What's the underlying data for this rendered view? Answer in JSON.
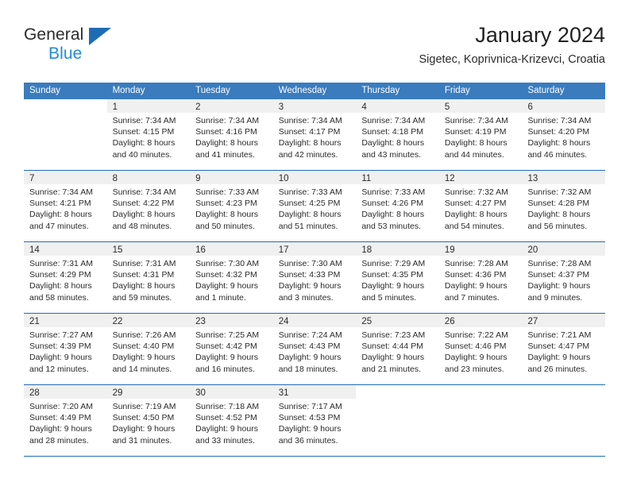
{
  "brand": {
    "line1": "General",
    "line2": "Blue",
    "triangle_color": "#1f6cb6",
    "blue_text_color": "#1f8bd8"
  },
  "header": {
    "title": "January 2024",
    "subtitle": "Sigetec, Koprivnica-Krizevci, Croatia"
  },
  "theme": {
    "header_row_bg": "#3a7cbe",
    "row_divider": "#1f6cb6",
    "day_number_band": "#f0f0f0"
  },
  "weekdays": [
    "Sunday",
    "Monday",
    "Tuesday",
    "Wednesday",
    "Thursday",
    "Friday",
    "Saturday"
  ],
  "weeks": [
    [
      {
        "day": "",
        "lines": []
      },
      {
        "day": "1",
        "lines": [
          "Sunrise: 7:34 AM",
          "Sunset: 4:15 PM",
          "Daylight: 8 hours",
          "and 40 minutes."
        ]
      },
      {
        "day": "2",
        "lines": [
          "Sunrise: 7:34 AM",
          "Sunset: 4:16 PM",
          "Daylight: 8 hours",
          "and 41 minutes."
        ]
      },
      {
        "day": "3",
        "lines": [
          "Sunrise: 7:34 AM",
          "Sunset: 4:17 PM",
          "Daylight: 8 hours",
          "and 42 minutes."
        ]
      },
      {
        "day": "4",
        "lines": [
          "Sunrise: 7:34 AM",
          "Sunset: 4:18 PM",
          "Daylight: 8 hours",
          "and 43 minutes."
        ]
      },
      {
        "day": "5",
        "lines": [
          "Sunrise: 7:34 AM",
          "Sunset: 4:19 PM",
          "Daylight: 8 hours",
          "and 44 minutes."
        ]
      },
      {
        "day": "6",
        "lines": [
          "Sunrise: 7:34 AM",
          "Sunset: 4:20 PM",
          "Daylight: 8 hours",
          "and 46 minutes."
        ]
      }
    ],
    [
      {
        "day": "7",
        "lines": [
          "Sunrise: 7:34 AM",
          "Sunset: 4:21 PM",
          "Daylight: 8 hours",
          "and 47 minutes."
        ]
      },
      {
        "day": "8",
        "lines": [
          "Sunrise: 7:34 AM",
          "Sunset: 4:22 PM",
          "Daylight: 8 hours",
          "and 48 minutes."
        ]
      },
      {
        "day": "9",
        "lines": [
          "Sunrise: 7:33 AM",
          "Sunset: 4:23 PM",
          "Daylight: 8 hours",
          "and 50 minutes."
        ]
      },
      {
        "day": "10",
        "lines": [
          "Sunrise: 7:33 AM",
          "Sunset: 4:25 PM",
          "Daylight: 8 hours",
          "and 51 minutes."
        ]
      },
      {
        "day": "11",
        "lines": [
          "Sunrise: 7:33 AM",
          "Sunset: 4:26 PM",
          "Daylight: 8 hours",
          "and 53 minutes."
        ]
      },
      {
        "day": "12",
        "lines": [
          "Sunrise: 7:32 AM",
          "Sunset: 4:27 PM",
          "Daylight: 8 hours",
          "and 54 minutes."
        ]
      },
      {
        "day": "13",
        "lines": [
          "Sunrise: 7:32 AM",
          "Sunset: 4:28 PM",
          "Daylight: 8 hours",
          "and 56 minutes."
        ]
      }
    ],
    [
      {
        "day": "14",
        "lines": [
          "Sunrise: 7:31 AM",
          "Sunset: 4:29 PM",
          "Daylight: 8 hours",
          "and 58 minutes."
        ]
      },
      {
        "day": "15",
        "lines": [
          "Sunrise: 7:31 AM",
          "Sunset: 4:31 PM",
          "Daylight: 8 hours",
          "and 59 minutes."
        ]
      },
      {
        "day": "16",
        "lines": [
          "Sunrise: 7:30 AM",
          "Sunset: 4:32 PM",
          "Daylight: 9 hours",
          "and 1 minute."
        ]
      },
      {
        "day": "17",
        "lines": [
          "Sunrise: 7:30 AM",
          "Sunset: 4:33 PM",
          "Daylight: 9 hours",
          "and 3 minutes."
        ]
      },
      {
        "day": "18",
        "lines": [
          "Sunrise: 7:29 AM",
          "Sunset: 4:35 PM",
          "Daylight: 9 hours",
          "and 5 minutes."
        ]
      },
      {
        "day": "19",
        "lines": [
          "Sunrise: 7:28 AM",
          "Sunset: 4:36 PM",
          "Daylight: 9 hours",
          "and 7 minutes."
        ]
      },
      {
        "day": "20",
        "lines": [
          "Sunrise: 7:28 AM",
          "Sunset: 4:37 PM",
          "Daylight: 9 hours",
          "and 9 minutes."
        ]
      }
    ],
    [
      {
        "day": "21",
        "lines": [
          "Sunrise: 7:27 AM",
          "Sunset: 4:39 PM",
          "Daylight: 9 hours",
          "and 12 minutes."
        ]
      },
      {
        "day": "22",
        "lines": [
          "Sunrise: 7:26 AM",
          "Sunset: 4:40 PM",
          "Daylight: 9 hours",
          "and 14 minutes."
        ]
      },
      {
        "day": "23",
        "lines": [
          "Sunrise: 7:25 AM",
          "Sunset: 4:42 PM",
          "Daylight: 9 hours",
          "and 16 minutes."
        ]
      },
      {
        "day": "24",
        "lines": [
          "Sunrise: 7:24 AM",
          "Sunset: 4:43 PM",
          "Daylight: 9 hours",
          "and 18 minutes."
        ]
      },
      {
        "day": "25",
        "lines": [
          "Sunrise: 7:23 AM",
          "Sunset: 4:44 PM",
          "Daylight: 9 hours",
          "and 21 minutes."
        ]
      },
      {
        "day": "26",
        "lines": [
          "Sunrise: 7:22 AM",
          "Sunset: 4:46 PM",
          "Daylight: 9 hours",
          "and 23 minutes."
        ]
      },
      {
        "day": "27",
        "lines": [
          "Sunrise: 7:21 AM",
          "Sunset: 4:47 PM",
          "Daylight: 9 hours",
          "and 26 minutes."
        ]
      }
    ],
    [
      {
        "day": "28",
        "lines": [
          "Sunrise: 7:20 AM",
          "Sunset: 4:49 PM",
          "Daylight: 9 hours",
          "and 28 minutes."
        ]
      },
      {
        "day": "29",
        "lines": [
          "Sunrise: 7:19 AM",
          "Sunset: 4:50 PM",
          "Daylight: 9 hours",
          "and 31 minutes."
        ]
      },
      {
        "day": "30",
        "lines": [
          "Sunrise: 7:18 AM",
          "Sunset: 4:52 PM",
          "Daylight: 9 hours",
          "and 33 minutes."
        ]
      },
      {
        "day": "31",
        "lines": [
          "Sunrise: 7:17 AM",
          "Sunset: 4:53 PM",
          "Daylight: 9 hours",
          "and 36 minutes."
        ]
      },
      {
        "day": "",
        "lines": []
      },
      {
        "day": "",
        "lines": []
      },
      {
        "day": "",
        "lines": []
      }
    ]
  ]
}
